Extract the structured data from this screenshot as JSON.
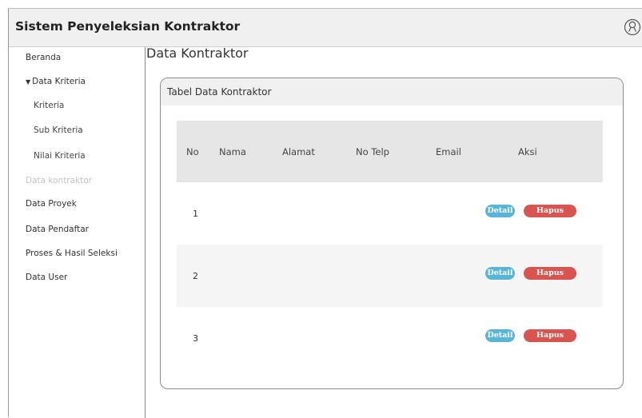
{
  "header": {
    "title": "Sistem Penyeleksian Kontraktor",
    "user_icon": "user-icon"
  },
  "sidebar": {
    "items": [
      {
        "label": "Beranda"
      },
      {
        "label": "Data Kriteria",
        "expanded": true
      },
      {
        "label": "Kriteria"
      },
      {
        "label": "Sub Kriteria"
      },
      {
        "label": "Nilai Kriteria"
      },
      {
        "label": "Data kontraktor",
        "active": true
      },
      {
        "label": "Data Proyek"
      },
      {
        "label": "Data Pendaftar"
      },
      {
        "label": "Proses & Hasil Seleksi"
      },
      {
        "label": "Data User"
      }
    ]
  },
  "main": {
    "title": "Data Kontraktor",
    "card_title": "Tabel Data Kontraktor",
    "columns": [
      "No",
      "Nama",
      "Alamat",
      "No Telp",
      "Email",
      "Aksi"
    ],
    "rows": [
      {
        "no": "1",
        "detail": "Detail",
        "delete": "Hapus"
      },
      {
        "no": "2",
        "detail": "Detail",
        "delete": "Hapus"
      },
      {
        "no": "3",
        "detail": "Detail",
        "delete": "Hapus"
      }
    ]
  },
  "colors": {
    "detail_button": "#58b5d8",
    "delete_button": "#d9534f",
    "header_bg": "#f0f0f0"
  }
}
